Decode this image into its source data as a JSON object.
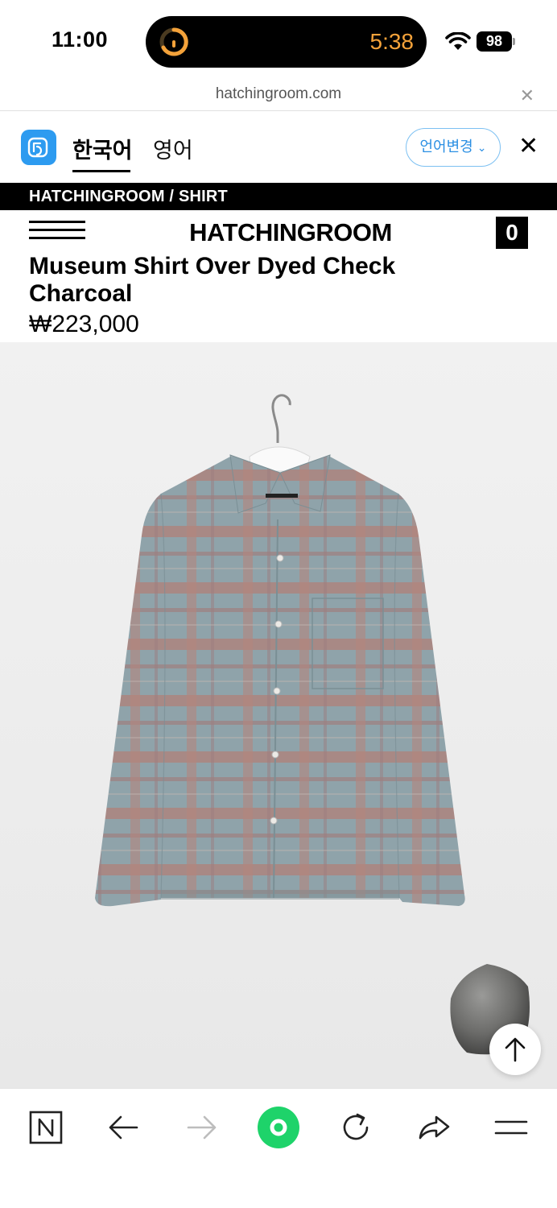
{
  "status": {
    "time": "11:00",
    "timer": "5:38",
    "battery": "98"
  },
  "browser": {
    "url": "hatchingroom.com"
  },
  "translate": {
    "tab_korean": "한국어",
    "tab_english": "영어",
    "change_language": "언어변경"
  },
  "site": {
    "breadcrumb": "HATCHINGROOM / SHIRT",
    "logo": "HATCHINGROOM",
    "cart_count": "0"
  },
  "product": {
    "title": "Museum Shirt Over Dyed Check Charcoal",
    "price": "₩223,000"
  },
  "colors": {
    "accent_blue": "#2b8fe3",
    "timer_orange": "#f4a23a",
    "green_button": "#1ed36a"
  },
  "icons": {
    "naver": "n-square-icon",
    "back": "arrow-left-icon",
    "forward": "arrow-right-icon",
    "home": "green-circle-icon",
    "reload": "reload-icon",
    "share": "share-icon",
    "menu": "menu-icon"
  }
}
